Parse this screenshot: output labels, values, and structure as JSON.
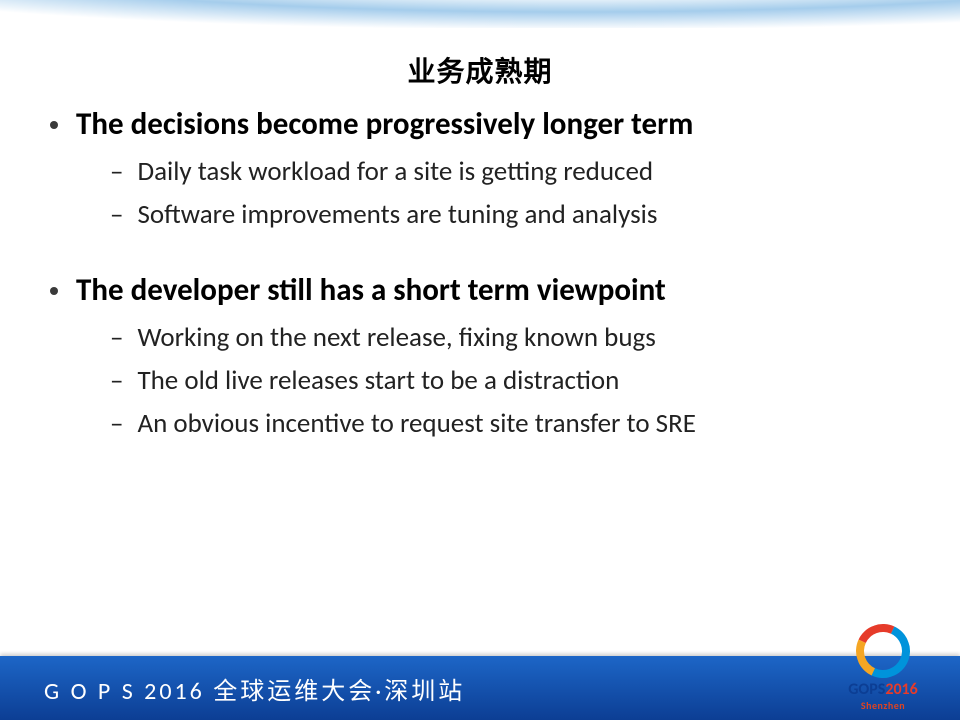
{
  "title": "业务成熟期",
  "bullets": [
    {
      "text": "The decisions become progressively longer term",
      "subs": [
        "Daily task workload for a site is getting reduced",
        "Software improvements are tuning and analysis"
      ]
    },
    {
      "text": "The developer still has a short term viewpoint",
      "subs": [
        "Working on the next release, fixing known bugs",
        "The old live releases start to be a distraction",
        "An obvious incentive to request site transfer to SRE"
      ]
    }
  ],
  "footer": "G O P S 2016 全球运维大会·深圳站",
  "logo": {
    "name": "GOPS",
    "year": "2016",
    "city": "Shenzhen"
  }
}
